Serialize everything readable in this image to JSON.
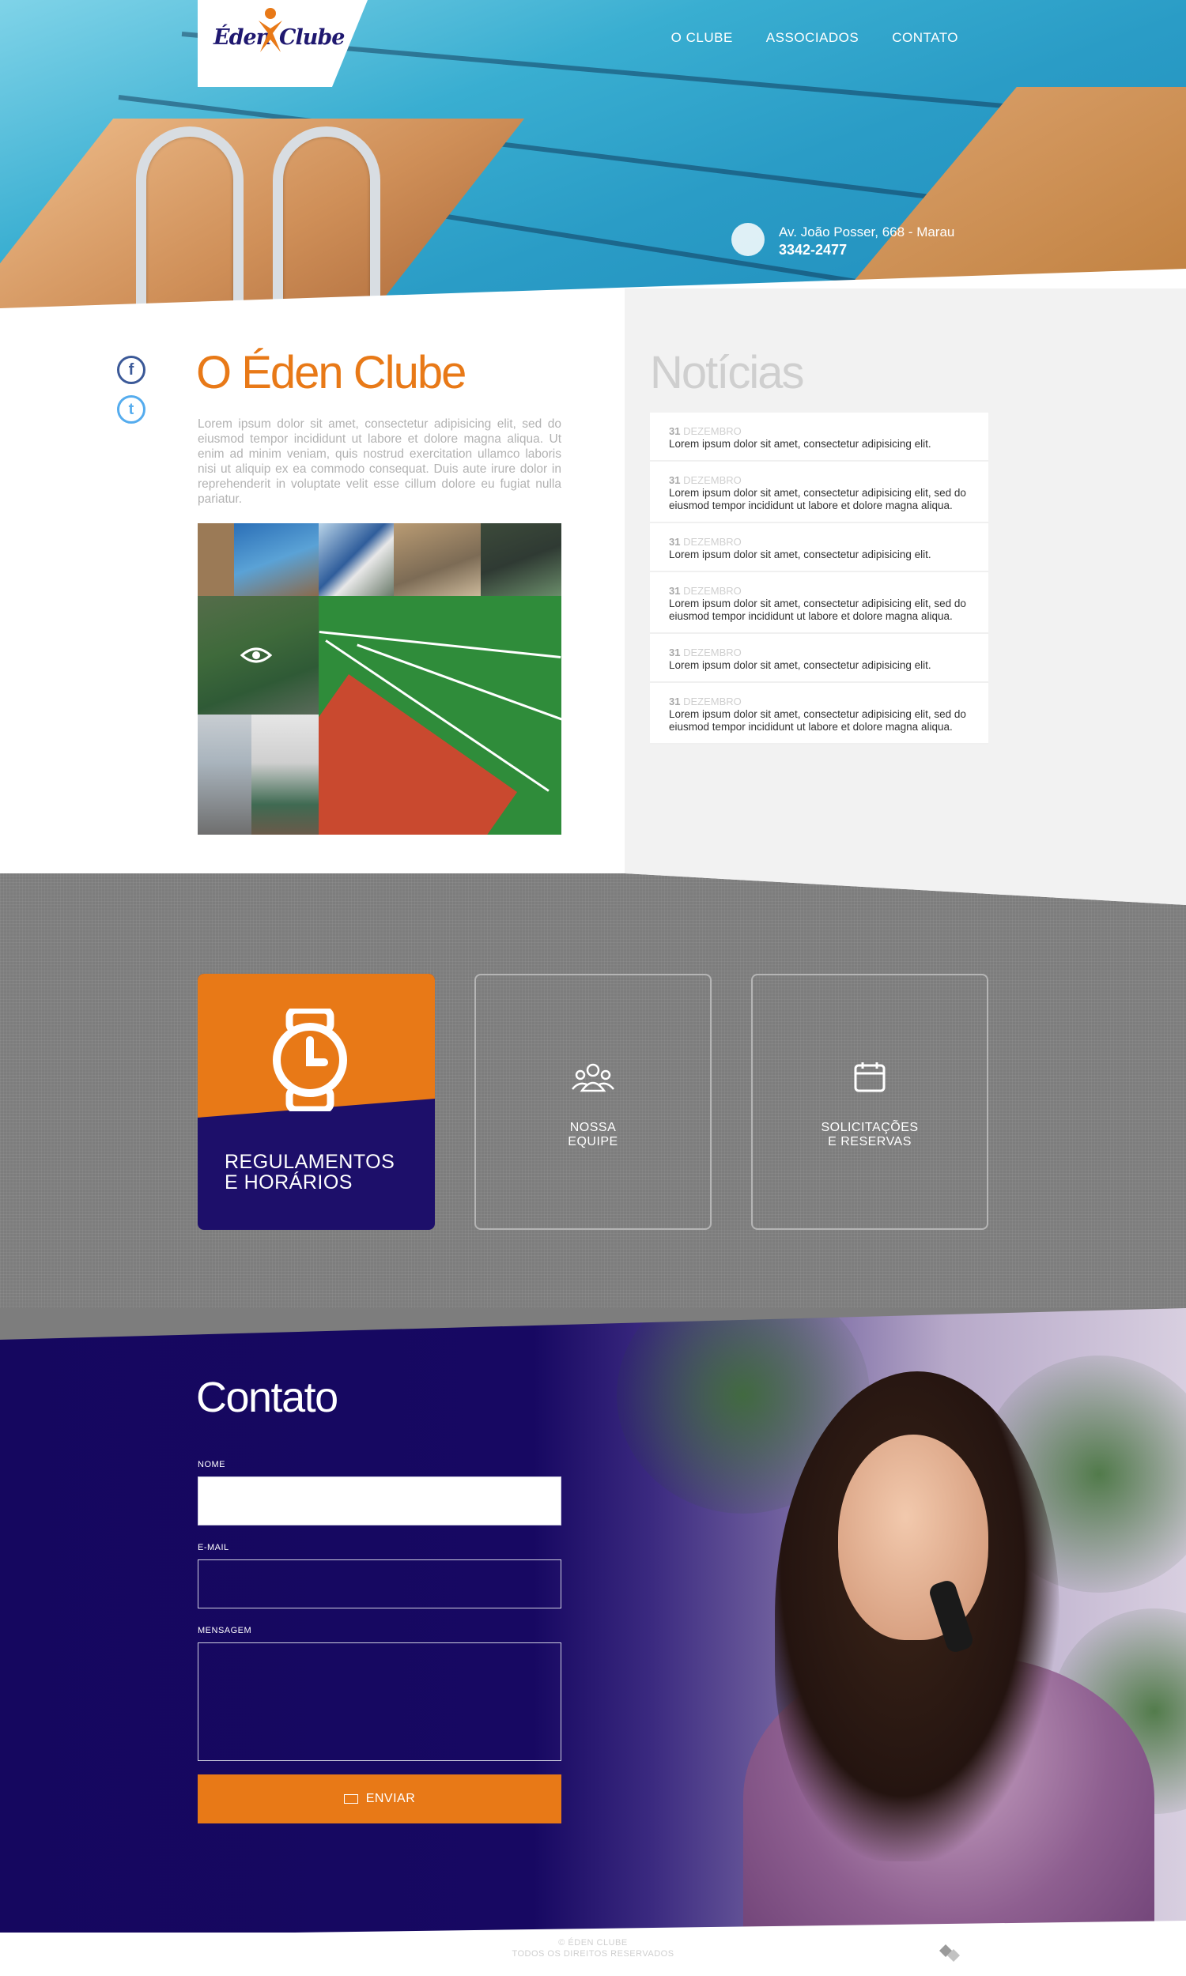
{
  "header": {
    "logo_left": "Éden",
    "logo_right": "Clube",
    "nav": [
      "O CLUBE",
      "ASSOCIADOS",
      "CONTATO"
    ],
    "address": "Av. João Posser, 668 - Marau",
    "phone": "3342-2477"
  },
  "about": {
    "social": [
      {
        "icon": "facebook-icon",
        "glyph": "f"
      },
      {
        "icon": "twitter-icon",
        "glyph": "t"
      }
    ],
    "title": "O Éden Clube",
    "text": "Lorem ipsum dolor sit amet, consectetur adipisicing elit, sed do eiusmod tempor incididunt ut labore et dolore magna aliqua. Ut enim ad minim veniam, quis nostrud exercitation ullamco laboris nisi ut aliquip ex ea commodo consequat. Duis aute irure dolor in reprehenderit in voluptate velit esse cillum dolore eu fugiat nulla pariatur."
  },
  "news": {
    "title": "Notícias",
    "items": [
      {
        "day": "31",
        "month": "DEZEMBRO",
        "text": "Lorem ipsum dolor sit amet, consectetur adipisicing elit."
      },
      {
        "day": "31",
        "month": "DEZEMBRO",
        "text": "Lorem ipsum dolor sit amet, consectetur adipisicing elit, sed do eiusmod tempor incididunt ut labore et dolore magna aliqua."
      },
      {
        "day": "31",
        "month": "DEZEMBRO",
        "text": "Lorem ipsum dolor sit amet, consectetur adipisicing elit."
      },
      {
        "day": "31",
        "month": "DEZEMBRO",
        "text": "Lorem ipsum dolor sit amet, consectetur adipisicing elit, sed do eiusmod tempor incididunt ut labore et dolore magna aliqua."
      },
      {
        "day": "31",
        "month": "DEZEMBRO",
        "text": "Lorem ipsum dolor sit amet, consectetur adipisicing elit."
      },
      {
        "day": "31",
        "month": "DEZEMBRO",
        "text": "Lorem ipsum dolor sit amet, consectetur adipisicing elit, sed do eiusmod tempor incididunt ut labore et dolore magna aliqua."
      }
    ]
  },
  "features": {
    "card1": {
      "line1": "REGULAMENTOS",
      "line2": "E HORÁRIOS",
      "icon": "watch-clock-icon"
    },
    "card2": {
      "line1": "NOSSA",
      "line2": "EQUIPE",
      "icon": "team-icon"
    },
    "card3": {
      "line1": "SOLICITAÇÕES",
      "line2": "E RESERVAS",
      "icon": "calendar-icon"
    }
  },
  "contact": {
    "title": "Contato",
    "name_label": "NOME",
    "email_label": "E-MAIL",
    "message_label": "MENSAGEM",
    "submit_label": "ENVIAR"
  },
  "footer": {
    "copyright": "© ÉDEN CLUBE",
    "rights": "TODOS OS DIREITOS RESERVADOS"
  },
  "colors": {
    "accent": "#e87917",
    "navy": "#1d0f6a",
    "gray_band": "#7d7d7d"
  }
}
